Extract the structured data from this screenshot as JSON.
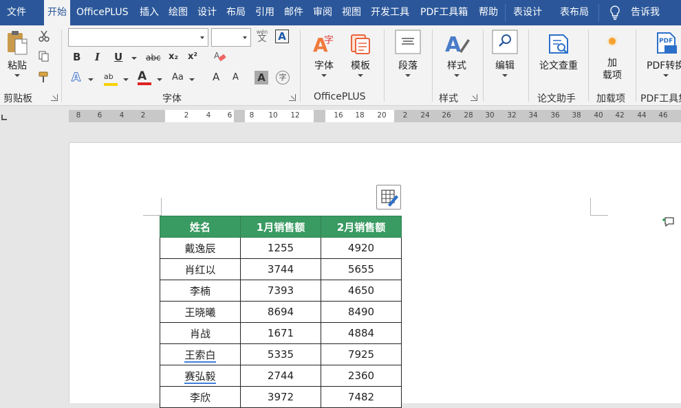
{
  "menubar": {
    "tabs": [
      "文件",
      "开始",
      "OfficePLUS",
      "插入",
      "绘图",
      "设计",
      "布局",
      "引用",
      "邮件",
      "审阅",
      "视图",
      "开发工具",
      "PDF工具箱",
      "帮助",
      "表设计",
      "表布局",
      "告诉我"
    ],
    "active": "开始",
    "bg": "#2b579a"
  },
  "ribbon": {
    "clipboard": {
      "paste": "粘贴",
      "label": "剪贴板"
    },
    "font": {
      "label": "字体",
      "font_name": "",
      "font_size": "",
      "bold": "B",
      "italic": "I",
      "underline": "U",
      "strike": "abc",
      "subscript": "x₂",
      "superscript": "x²",
      "phonetic": "文",
      "phonetic_top": "wén",
      "border_char": "A",
      "circle_char": "字",
      "grow": "A",
      "shrink": "A",
      "case": "Aa",
      "shade": "A",
      "highlight": "ab",
      "color": "A"
    },
    "officeplus": {
      "font_btn": "字体",
      "template_btn": "模板",
      "label": "OfficePLUS",
      "font_icon_char": "字"
    },
    "paragraph": {
      "btn": "段落"
    },
    "styles": {
      "btn": "样式",
      "label": "样式"
    },
    "editing": {
      "btn": "编辑"
    },
    "thesis": {
      "btn": "论文查重",
      "label": "论文助手"
    },
    "addins": {
      "btn_line1": "加",
      "btn_line2": "载项",
      "label": "加载项"
    },
    "pdf": {
      "btn": "PDF转换",
      "label": "PDF工具集",
      "icon_text": "PDF"
    }
  },
  "ruler": {
    "left_numbers": [
      "8",
      "6",
      "4",
      "2"
    ],
    "mid_numbers": [
      "2",
      "4",
      "6",
      "8",
      "10",
      "12",
      "16",
      "18",
      "20"
    ],
    "right_numbers": [
      "2",
      "24",
      "26",
      "28",
      "30",
      "32",
      "34",
      "36",
      "38",
      "40",
      "42",
      "44",
      "46"
    ]
  },
  "table": {
    "headers": [
      "姓名",
      "1月销售额",
      "2月销售额"
    ],
    "rows": [
      [
        "戴逸辰",
        "1255",
        "4920"
      ],
      [
        "肖红以",
        "3744",
        "5655"
      ],
      [
        "李楠",
        "7393",
        "4650"
      ],
      [
        "王晓曦",
        "8694",
        "8490"
      ],
      [
        "肖战",
        "1671",
        "4884"
      ],
      [
        "王索白",
        "5335",
        "7925"
      ],
      [
        "赛弘毅",
        "2744",
        "2360"
      ],
      [
        "李欣",
        "3972",
        "7482"
      ]
    ],
    "header_bg": "#3a9b62"
  }
}
